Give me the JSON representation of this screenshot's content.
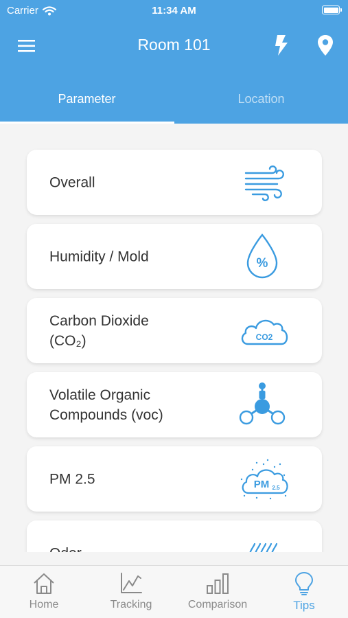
{
  "status_bar": {
    "carrier": "Carrier",
    "time": "11:34 AM"
  },
  "nav": {
    "title": "Room 101"
  },
  "tabs": [
    {
      "label": "Parameter",
      "active": true
    },
    {
      "label": "Location",
      "active": false
    }
  ],
  "parameters": [
    {
      "line1": "Overall",
      "line2": "",
      "icon": "wind-icon"
    },
    {
      "line1": "Humidity / Mold",
      "line2": "",
      "icon": "humidity-drop-icon"
    },
    {
      "line1": "Carbon Dioxide",
      "line2": "(CO₂)",
      "icon": "co2-cloud-icon"
    },
    {
      "line1": "Volatile Organic",
      "line2": "Compounds (voc)",
      "icon": "molecule-icon"
    },
    {
      "line1": "PM 2.5",
      "line2": "",
      "icon": "pm25-cloud-icon"
    },
    {
      "line1": "Odor",
      "line2": "",
      "icon": "odor-waves-icon"
    }
  ],
  "icon_texts": {
    "humidity": "%",
    "co2": "CO2",
    "pm": "PM",
    "pm_sub": "2.5"
  },
  "bottom_nav": [
    {
      "label": "Home",
      "icon": "home-icon"
    },
    {
      "label": "Tracking",
      "icon": "line-chart-icon"
    },
    {
      "label": "Comparison",
      "icon": "bar-chart-icon"
    },
    {
      "label": "Tips",
      "icon": "lightbulb-icon",
      "active": true
    }
  ],
  "colors": {
    "accent": "#4da3e3",
    "header_bg": "#4da3e3",
    "inactive": "#8a8a8a"
  }
}
